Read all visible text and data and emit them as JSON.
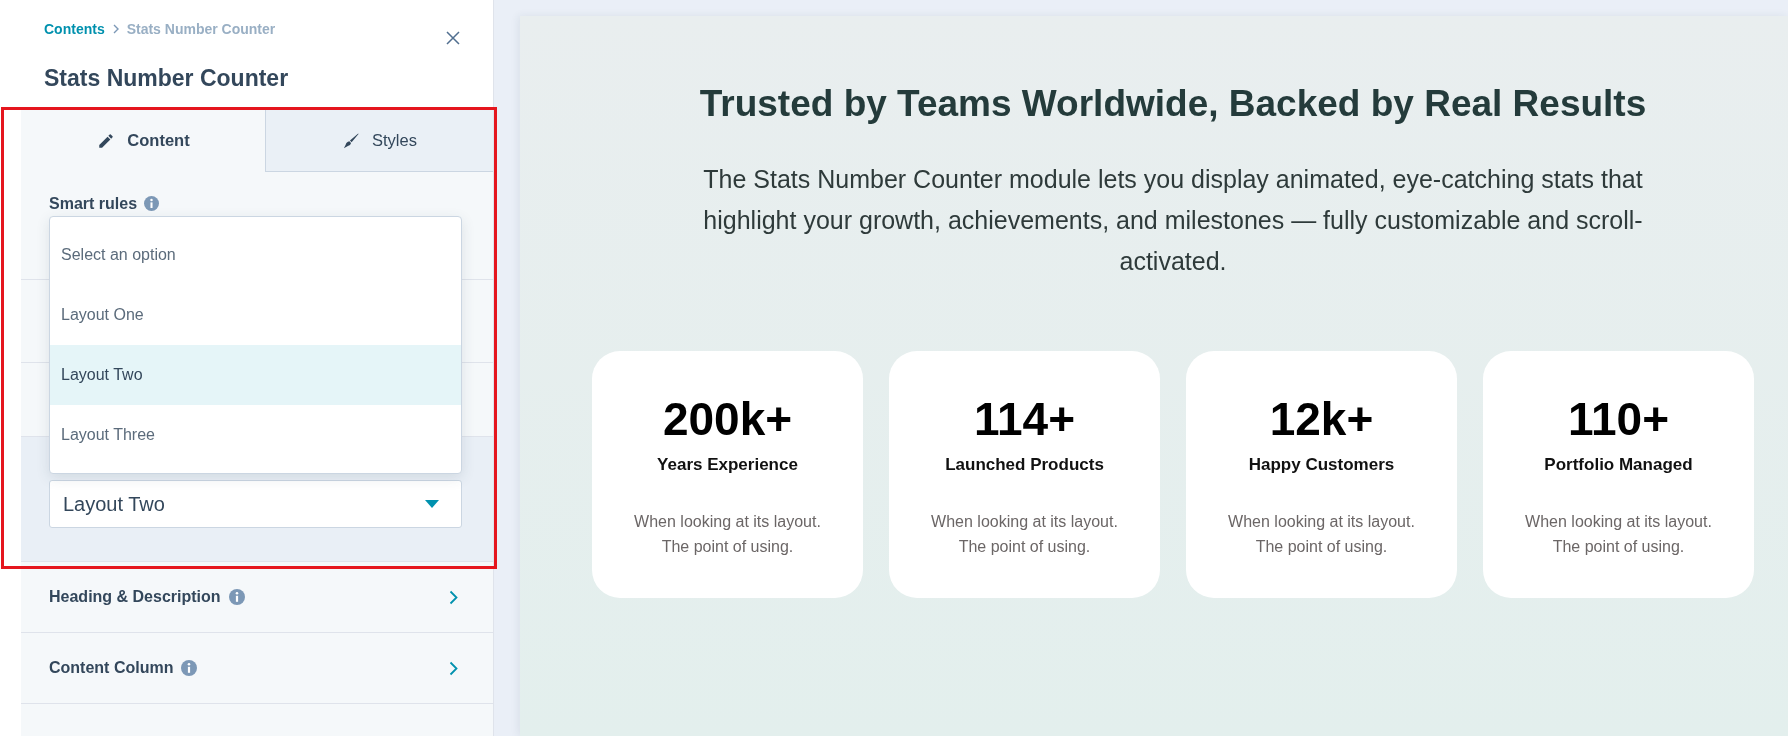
{
  "panel": {
    "breadcrumb": [
      {
        "label": "Contents"
      },
      {
        "label": "Stats Number Counter"
      }
    ],
    "title": "Stats Number Counter"
  },
  "tabs": [
    {
      "label": "Content",
      "selected": true
    },
    {
      "label": "Styles",
      "selected": false
    }
  ],
  "smart_rules": {
    "label": "Smart rules"
  },
  "layout_select": {
    "value": "Layout Two",
    "expanded": true,
    "options": [
      {
        "label": "Select an option",
        "selected": false
      },
      {
        "label": "Layout One",
        "selected": false
      },
      {
        "label": "Layout Two",
        "selected": true
      },
      {
        "label": "Layout Three",
        "selected": false
      }
    ]
  },
  "sections": [
    {
      "label": "Heading & Description"
    },
    {
      "label": "Content Column"
    }
  ],
  "preview": {
    "heading": "Trusted by Teams Worldwide, Backed by Real Results",
    "description": "The Stats Number Counter module lets you display animated, eye-catching stats that highlight your growth, achievements, and milestones — fully customizable and scroll-activated.",
    "stats": [
      {
        "value": "200k+",
        "label": "Years Experience",
        "text": "When looking at its layout. The point of using."
      },
      {
        "value": "114+",
        "label": "Launched Products",
        "text": "When looking at its layout. The point of using."
      },
      {
        "value": "12k+",
        "label": "Happy Customers",
        "text": "When looking at its layout. The point of using."
      },
      {
        "value": "110+",
        "label": "Portfolio Managed",
        "text": "When looking at its layout. The point of using."
      }
    ]
  }
}
